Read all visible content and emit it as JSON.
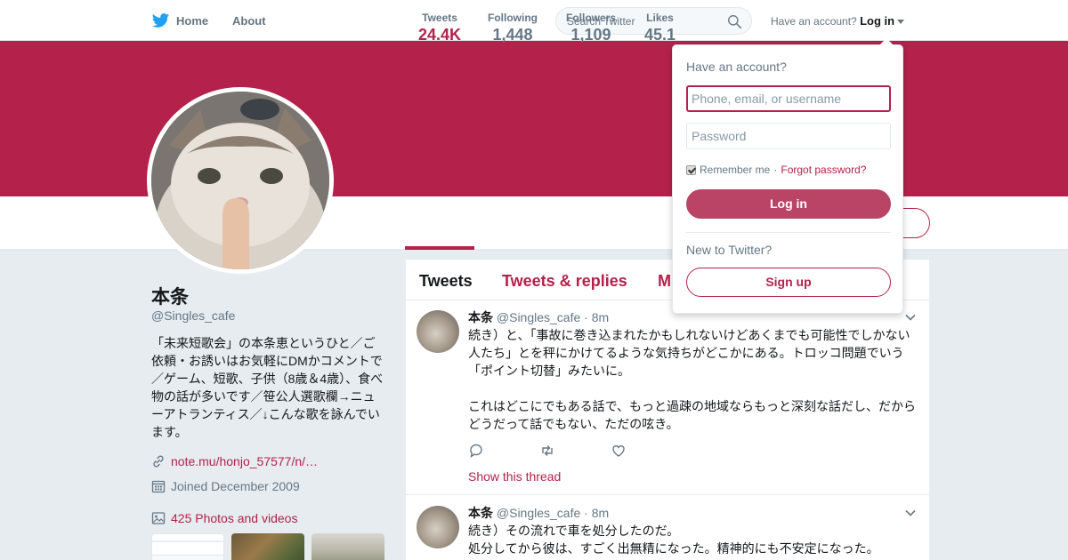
{
  "nav": {
    "home_label": "Home",
    "about_label": "About",
    "search_placeholder": "Search Twitter",
    "have_account": "Have an account?",
    "login_label": "Log in"
  },
  "colors": {
    "theme": "#b4214a",
    "background": "#e6ecf0",
    "text_muted": "#657786"
  },
  "stats": [
    {
      "label": "Tweets",
      "value": "24.4K"
    },
    {
      "label": "Following",
      "value": "1,448"
    },
    {
      "label": "Followers",
      "value": "1,109"
    },
    {
      "label": "Likes",
      "value": "45.1"
    }
  ],
  "profile": {
    "name": "本条",
    "handle": "@Singles_cafe",
    "bio": "「未来短歌会」の本条恵というひと／ご依頼・お誘いはお気軽にDMかコメントで／ゲーム、短歌、子供（8歳＆4歳）、食べ物の話が多いです／笹公人選歌欄→ニューアトランティス／↓こんな歌を詠んでいます。",
    "link": "note.mu/honjo_57577/n/…",
    "joined": "Joined December 2009",
    "photos": "425 Photos and videos"
  },
  "timeline": {
    "tabs": [
      "Tweets",
      "Tweets & replies",
      "M"
    ],
    "tweets": [
      {
        "name": "本条",
        "handle": "@Singles_cafe",
        "time": "· 8m",
        "text": "続き）と、「事故に巻き込まれたかもしれないけどあくまでも可能性でしかない人たち」とを秤にかけてるような気持ちがどこかにある。トロッコ問題でいう「ポイント切替」みたいに。\n\nこれはどこにでもある話で、もっと過疎の地域ならもっと深刻な話だし、だからどうだって話でもない、ただの呟き。",
        "thread_link": "Show this thread"
      },
      {
        "name": "本条",
        "handle": "@Singles_cafe",
        "time": "· 8m",
        "text": "続き）その流れで車を処分したのだ。\n処分してから彼は、すごく出無精になった。精神的にも不安定になった。"
      }
    ]
  },
  "login_dropdown": {
    "title": "Have an account?",
    "username_placeholder": "Phone, email, or username",
    "password_placeholder": "Password",
    "remember_label": "Remember me",
    "separator": "·",
    "forgot_label": "Forgot password?",
    "login_button": "Log in",
    "new_label": "New to Twitter?",
    "signup_button": "Sign up"
  },
  "icons": [
    "twitter-bird-icon",
    "home-icon",
    "search-icon",
    "caret-down-icon",
    "link-icon",
    "calendar-icon",
    "photo-icon",
    "reply-icon",
    "retweet-icon",
    "like-icon",
    "chevron-down-icon"
  ]
}
